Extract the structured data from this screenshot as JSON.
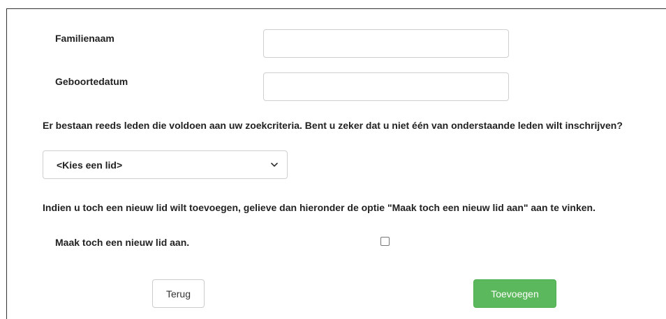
{
  "form": {
    "surname_label": "Familienaam",
    "surname_value": "",
    "birthdate_label": "Geboortedatum",
    "birthdate_value": "",
    "existing_members_message": "Er bestaan reeds leden die voldoen aan uw zoekcriteria. Bent u zeker dat u niet één van onderstaande leden wilt inschrijven?",
    "member_select": {
      "selected": "<Kies een lid>"
    },
    "new_member_instruction": "Indien u toch een nieuw lid wilt toevoegen, gelieve dan hieronder de optie \"Maak toch een nieuw lid aan\" aan te vinken.",
    "new_member_checkbox_label": "Maak toch een nieuw lid aan.",
    "new_member_checked": false
  },
  "buttons": {
    "back_label": "Terug",
    "add_label": "Toevoegen"
  },
  "colors": {
    "primary_button": "#5cb85c",
    "text": "#222222",
    "input_border": "#cfcfcf"
  }
}
